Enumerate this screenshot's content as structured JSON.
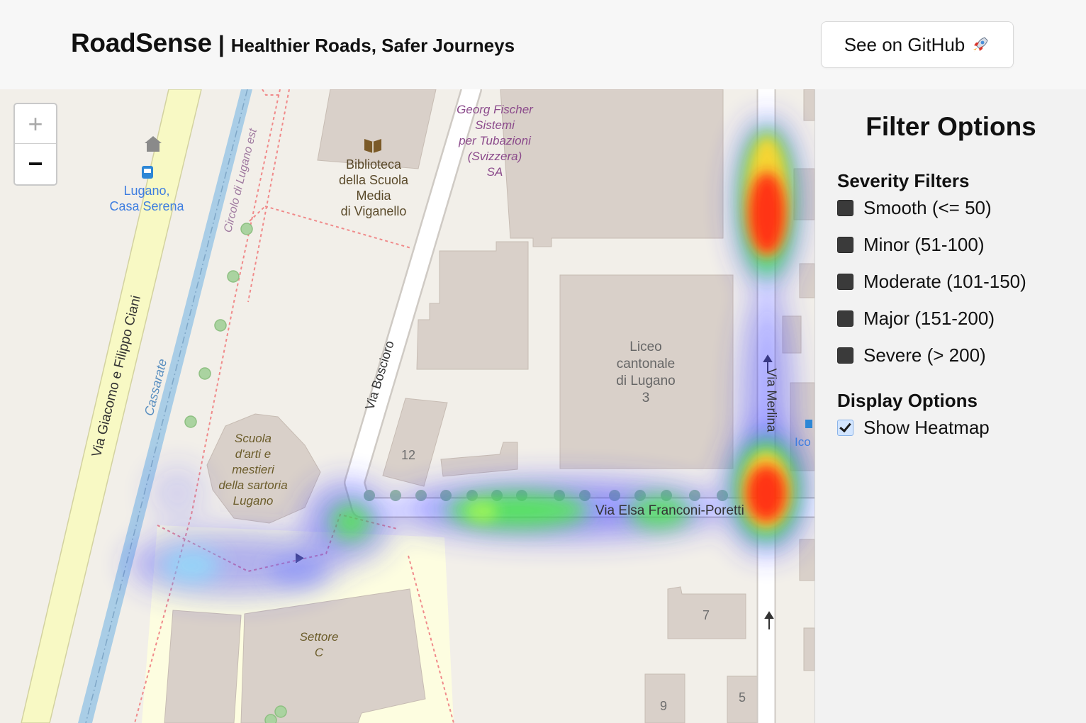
{
  "header": {
    "brand": "RoadSense",
    "separator": "|",
    "tagline": "Healthier Roads, Safer Journeys",
    "github_button": "See on GitHub"
  },
  "map": {
    "zoom_in": "+",
    "zoom_out": "−",
    "labels": {
      "bus_stop": [
        "Lugano,",
        "Casa Serena"
      ],
      "library": [
        "Biblioteca",
        "della Scuola",
        "Media",
        "di Viganello"
      ],
      "company": [
        "Georg Fischer",
        "Sistemi",
        "per Tubazioni",
        "(Svizzera)",
        "SA"
      ],
      "liceo": [
        "Liceo",
        "cantonale",
        "di Lugano",
        "3"
      ],
      "scuola": [
        "Scuola",
        "d'arti e",
        "mestieri",
        "della sartoria",
        "Lugano"
      ],
      "settore": [
        "Settore",
        "C"
      ],
      "road_giacomo": "Via Giacomo e Filippo Ciani",
      "river": "Cassarate",
      "circolo": "Circolo di Lugano est",
      "boscioro": "Via Boscioro",
      "merlina": "Via Merlina",
      "franconi": "Via Elsa Franconi-Poretti",
      "edge_label": "Ico",
      "numbers": [
        "12",
        "7",
        "9",
        "5"
      ]
    },
    "icons": [
      "bus-stop-icon",
      "library-book-icon",
      "house-icon",
      "info-icon"
    ]
  },
  "sidebar": {
    "title": "Filter Options",
    "severity_title": "Severity Filters",
    "severity_options": [
      {
        "label": "Smooth (<= 50)",
        "checked": false
      },
      {
        "label": "Minor (51-100)",
        "checked": false
      },
      {
        "label": "Moderate (101-150)",
        "checked": false
      },
      {
        "label": "Major (151-200)",
        "checked": false
      },
      {
        "label": "Severe (> 200)",
        "checked": false
      }
    ],
    "display_title": "Display Options",
    "display_options": [
      {
        "label": "Show Heatmap",
        "checked": true
      }
    ]
  },
  "colors": {
    "map_bg": "#f2efe9",
    "building": "#d9d0c9",
    "river": "#a9cde6",
    "main_road": "#f7fabf",
    "boundary": "#f08a8a",
    "heat_low": "#3f3fff",
    "heat_mid": "#33dd33",
    "heat_high": "#ff1a00"
  }
}
